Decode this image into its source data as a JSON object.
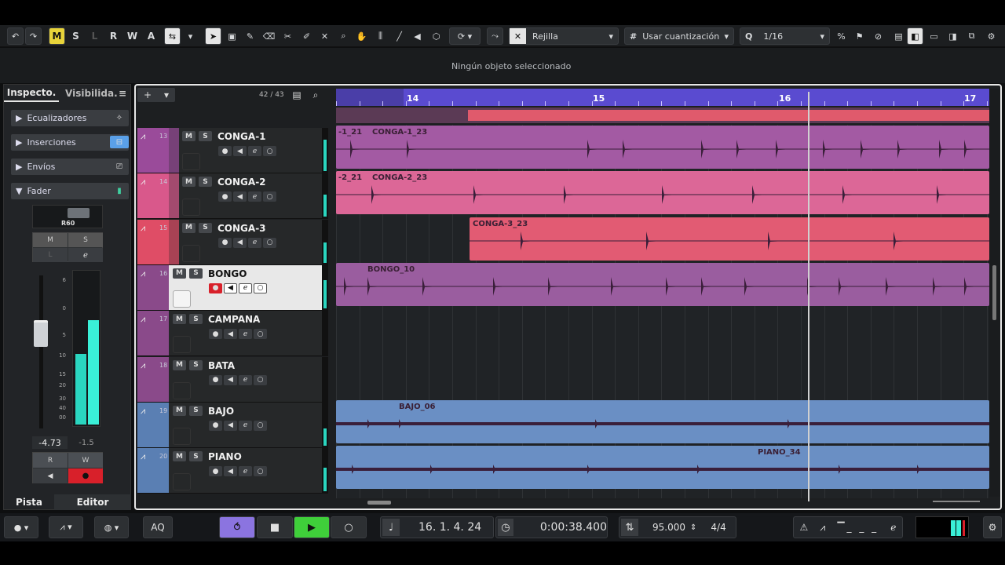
{
  "toolbar": {
    "modes": [
      "M",
      "S",
      "L",
      "R",
      "W",
      "A"
    ],
    "snap_label": "Rejilla",
    "quantize_label": "Usar cuantización",
    "quantize_value": "1/16"
  },
  "info": {
    "status": "Ningún objeto seleccionado"
  },
  "inspector": {
    "tabs": [
      "Inspecto.",
      "Visibilida."
    ],
    "sections": [
      "Ecualizadores",
      "Inserciones",
      "Envíos",
      "Fader"
    ],
    "pan_label": "R60",
    "fader_scale": [
      "6",
      "0",
      "5",
      "10",
      "15",
      "20",
      "30",
      "40",
      "00"
    ],
    "volume_value": "-4.73",
    "peak_value": "-1.5",
    "ms_labels": [
      "M",
      "S"
    ],
    "rw_labels": [
      "R",
      "W"
    ],
    "bottom_tabs": [
      "Pista",
      "Editor"
    ]
  },
  "tracklist": {
    "counter": "42 / 43",
    "tracks": [
      {
        "num": "13",
        "name": "CONGA-1",
        "color": "#9a4b9a"
      },
      {
        "num": "14",
        "name": "CONGA-2",
        "color": "#d9588b"
      },
      {
        "num": "15",
        "name": "CONGA-3",
        "color": "#df4d66"
      },
      {
        "num": "16",
        "name": "BONGO",
        "color": "#8a4a8a"
      },
      {
        "num": "17",
        "name": "CAMPANA",
        "color": "#8a4a8a"
      },
      {
        "num": "18",
        "name": "BATA",
        "color": "#8a4a8a"
      },
      {
        "num": "19",
        "name": "BAJO",
        "color": "#5a7fb3"
      },
      {
        "num": "20",
        "name": "PIANO",
        "color": "#5a7fb3"
      }
    ]
  },
  "ruler": {
    "bars": [
      "14",
      "15",
      "16",
      "17"
    ]
  },
  "clips": [
    {
      "lane": 0,
      "labels": [
        "-1_21",
        "CONGA-1_23"
      ],
      "color": "#a35aa3"
    },
    {
      "lane": 1,
      "labels": [
        "-2_21",
        "CONGA-2_23"
      ],
      "color": "#dc6797"
    },
    {
      "lane": 2,
      "labels": [
        "CONGA-3_23"
      ],
      "color": "#e25b73"
    },
    {
      "lane": 3,
      "labels": [
        "BONGO_10"
      ],
      "color": "#9a5d9f"
    },
    {
      "lane": 6,
      "labels": [
        "BAJO_06"
      ],
      "color": "#6a8fc4"
    },
    {
      "lane": 7,
      "labels": [
        "PIANO_34"
      ],
      "color": "#6a8fc4"
    }
  ],
  "transport": {
    "aq": "AQ",
    "position": "16. 1. 4. 24",
    "time": "0:00:38.400",
    "tempo": "95.000",
    "signature": "4/4"
  },
  "colors": {
    "accent": "#5a4bd0",
    "play": "#3fcf3a",
    "record": "#d8202a"
  }
}
